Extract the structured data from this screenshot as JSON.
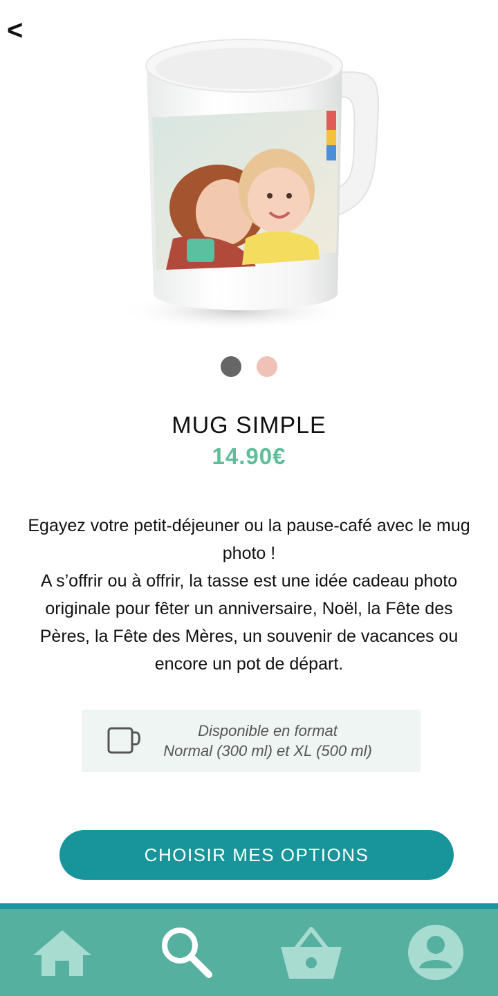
{
  "header": {
    "back_label": "<"
  },
  "carousel": {
    "active_index": 0,
    "dots": [
      {
        "state": "active",
        "color": "#666666"
      },
      {
        "state": "inactive",
        "color": "#f0c1b7"
      }
    ]
  },
  "product": {
    "title": "MUG SIMPLE",
    "price": "14.90€",
    "description": [
      "Egayez votre petit-déjeuner ou la pause-café avec le mug photo !",
      "A s’offrir ou à offrir, la tasse est une idée cadeau photo originale pour fêter un anniversaire, Noël, la Fête des Pères, la Fête des Mères, un souvenir de vacances ou encore un pot de départ."
    ],
    "format_line1": "Disponible en format",
    "format_line2": "Normal (300 ml) et XL (500 ml)"
  },
  "cta": {
    "label": "CHOISIR MES OPTIONS"
  },
  "nav": {
    "items": [
      {
        "icon": "home-icon"
      },
      {
        "icon": "search-icon",
        "active": true
      },
      {
        "icon": "basket-icon"
      },
      {
        "icon": "account-icon"
      }
    ]
  },
  "colors": {
    "price": "#5cbe9a",
    "cta": "#18959a",
    "nav_background": "#55b09f",
    "nav_top_line": "#1a96a0",
    "nav_icon_inactive": "#a9dcd0",
    "nav_icon_active": "#ffffff",
    "format_box": "#eef5f3"
  }
}
